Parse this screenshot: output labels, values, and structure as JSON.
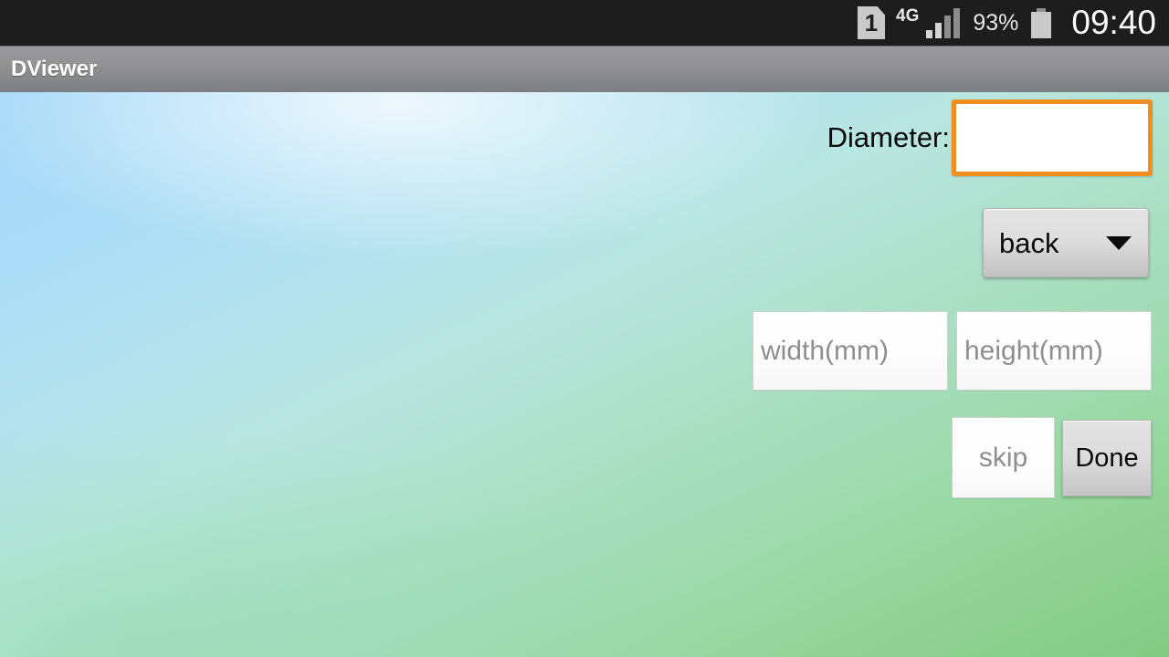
{
  "status_bar": {
    "sim_icon": "sim-card-icon",
    "sim_label": "1",
    "network_type": "4G",
    "signal_icon": "signal-bars-icon",
    "signal_bars_active": 2,
    "battery_percent": "93%",
    "battery_icon": "battery-icon",
    "clock": "09:40"
  },
  "title_bar": {
    "app_title": "DViewer"
  },
  "main": {
    "diameter": {
      "label": "Diameter:",
      "value": "",
      "placeholder": "",
      "focused": true,
      "focus_color": "#ef8f1f"
    },
    "spinner": {
      "selected": "back",
      "caret_icon": "chevron-down-icon"
    },
    "dimensions": {
      "width": {
        "value": "",
        "placeholder": "width(mm)"
      },
      "height": {
        "value": "",
        "placeholder": "height(mm)"
      }
    },
    "actions": {
      "skip": {
        "value": "",
        "placeholder": "skip"
      },
      "done_label": "Done"
    }
  },
  "theme": {
    "status_bar_bg": "#1d1d1d",
    "title_bar_top": "#9a9a9c",
    "title_bar_bottom": "#7c7e82",
    "background_top_left": "#a6d8f8",
    "background_bottom_right": "#83c983",
    "accent_orange": "#ef8f1f"
  }
}
